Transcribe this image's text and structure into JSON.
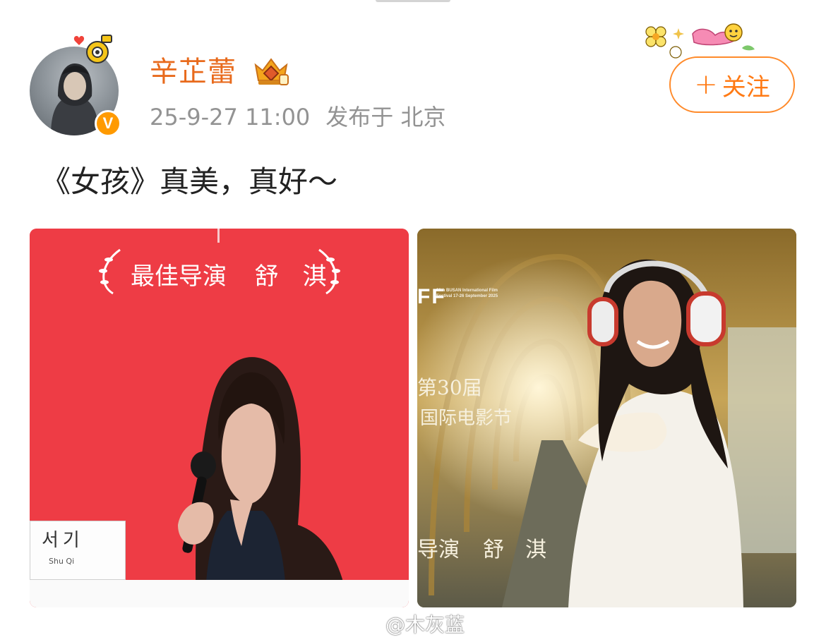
{
  "post": {
    "author": {
      "name": "辛芷蕾",
      "verified_mark": "V"
    },
    "timestamp": "25-9-27 11:00",
    "location_prefix": "发布于",
    "location": "北京",
    "follow_button": {
      "icon": "+",
      "label": "关注"
    },
    "text": "《女孩》真美，真好～",
    "images": [
      {
        "award_title": "最佳导演",
        "award_name": "舒　淇",
        "name_plate_korean": "서기",
        "name_plate_roman": "Shu Qi"
      },
      {
        "festival_logo": "FF",
        "festival_small": "30th BUSAN International Film Festival 17-26 September 2025",
        "edition": "第30届",
        "festival_name": "国际电影节",
        "award_title": "导演",
        "award_name": "舒　淇"
      }
    ]
  },
  "watermark": "@木灰蓝",
  "colors": {
    "username": "#e86a1c",
    "follow_accent": "#ff7a14",
    "meta_gray": "#939393",
    "verified_badge": "#ff9a00"
  }
}
